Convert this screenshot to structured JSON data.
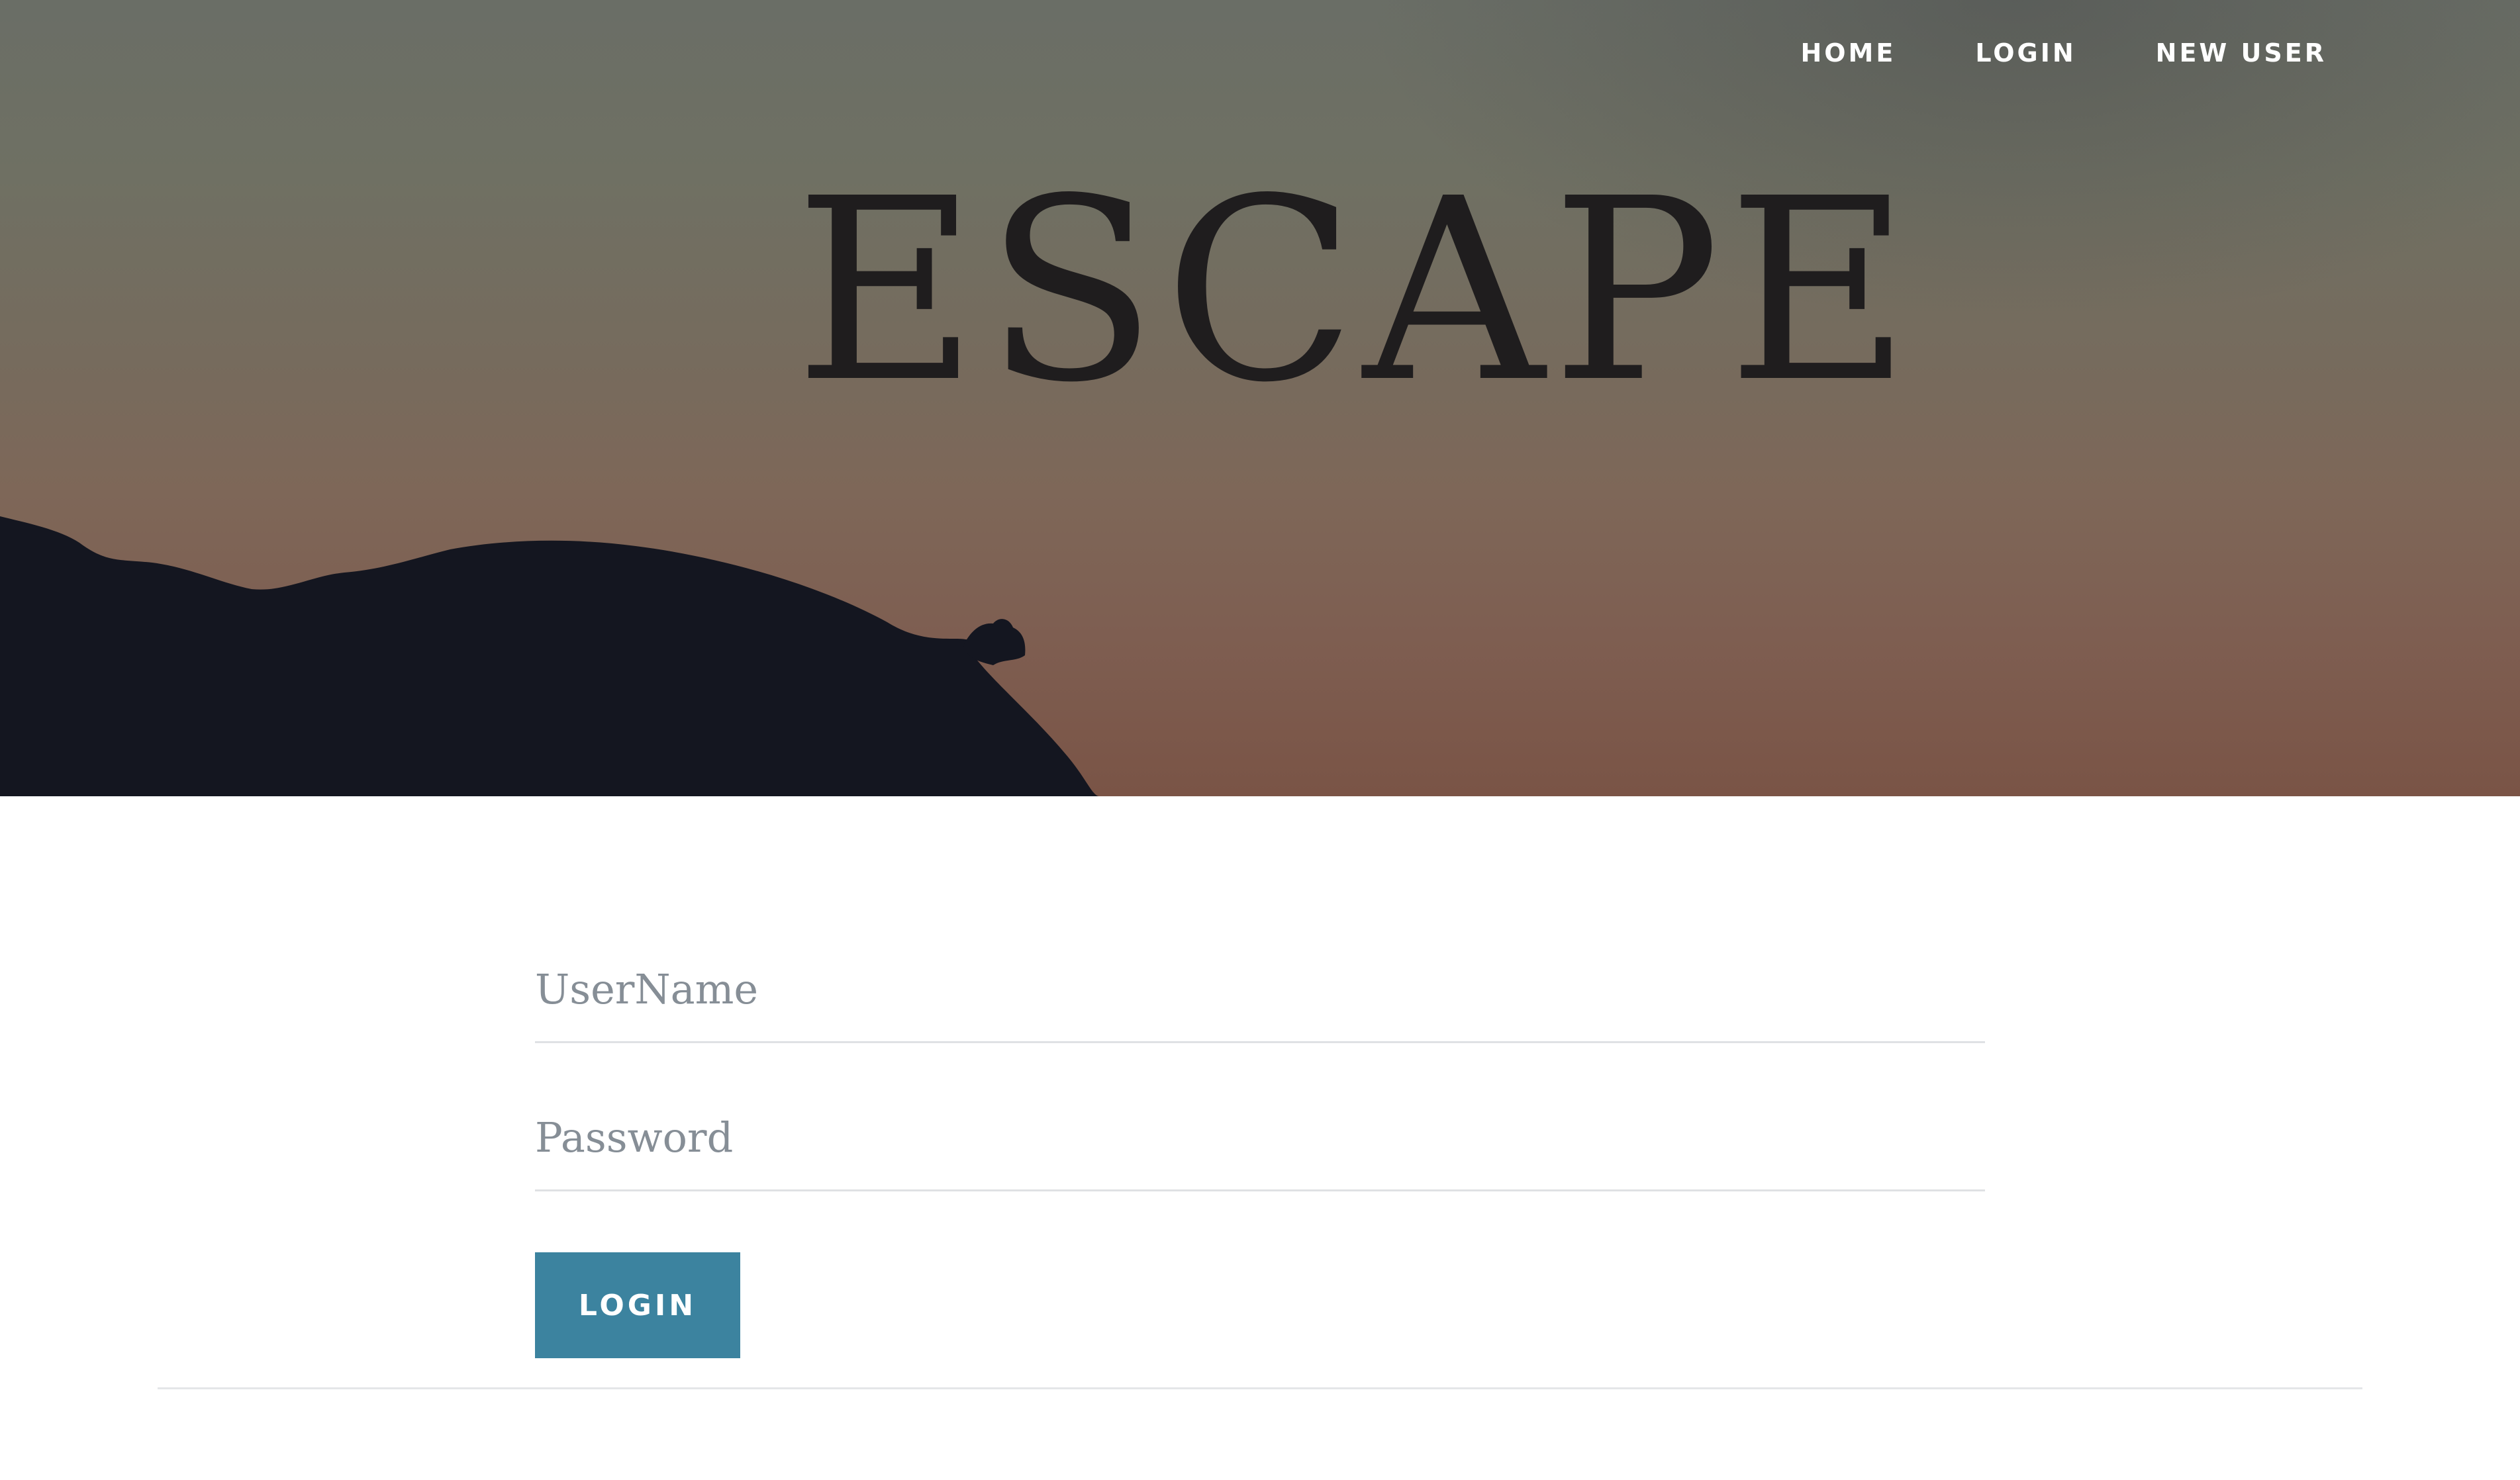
{
  "hero": {
    "title": "ESCAPE"
  },
  "nav": {
    "items": [
      {
        "label": "HOME"
      },
      {
        "label": "LOGIN"
      },
      {
        "label": "NEW USER"
      }
    ]
  },
  "login_form": {
    "username_placeholder": "UserName",
    "username_value": "",
    "password_placeholder": "Password",
    "password_value": "",
    "submit_label": "LOGIN"
  },
  "colors": {
    "accent": "#3c839f",
    "nav_text": "#ffffff",
    "title_text": "#1f1d1e",
    "placeholder": "#868e96"
  }
}
